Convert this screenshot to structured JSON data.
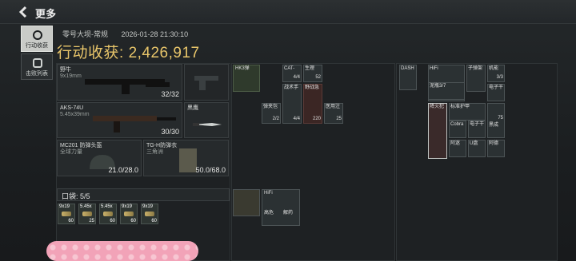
{
  "topbar": {
    "back_icon": "chevron-left-icon",
    "title": "更多"
  },
  "sidebar": {
    "items": [
      {
        "label": "行动收获",
        "icon": "target-icon",
        "active": true
      },
      {
        "label": "击败列表",
        "icon": "skull-icon",
        "active": false
      }
    ]
  },
  "header": {
    "map": "零号大坝-常规",
    "datetime": "2026-01-28 21:30:10",
    "loot_label": "行动收获:",
    "loot_value": "2,426,917"
  },
  "weapons": [
    {
      "name": "野牛",
      "ammo_type": "9x19mm",
      "value": "32/32"
    },
    {
      "name": "AKS-74U",
      "ammo_type": "5.45x39mm",
      "value": "30/30"
    }
  ],
  "melee": {
    "name": "黑鹰"
  },
  "armor": [
    {
      "name": "MC201 防弹头盔",
      "sub": "全球力量",
      "value": "21.0/28.0"
    },
    {
      "name": "TG-H防弹衣",
      "sub": "三角洲",
      "value": "50.0/68.0"
    }
  ],
  "pocket": {
    "label": "口袋: 5/5",
    "ammo": [
      {
        "type": "9x19",
        "count": "60"
      },
      {
        "type": "5.45x",
        "count": "25"
      },
      {
        "type": "5.45x",
        "count": "60"
      },
      {
        "type": "9x19",
        "count": "60"
      },
      {
        "type": "9x19",
        "count": "60"
      }
    ]
  },
  "rig": {
    "items": [
      {
        "name": "HK3弹",
        "count": ""
      },
      {
        "name": "CAT-",
        "count": "4/4"
      },
      {
        "name": "生理",
        "count": "52"
      },
      {
        "name": "战术手",
        "count": "4/4"
      },
      {
        "name": "野战急",
        "count": "220"
      },
      {
        "name": "弹夹包",
        "count": "2/2"
      },
      {
        "name": "医用注",
        "count": "25"
      }
    ]
  },
  "backpack": {
    "items": [
      {
        "name": "DASH",
        "count": ""
      },
      {
        "name": "HiFi",
        "count": ""
      },
      {
        "name": "子弹架",
        "count": ""
      },
      {
        "name": "机能",
        "count": "3/3"
      },
      {
        "name": "泥瓶3/7",
        "count": ""
      },
      {
        "name": "电子干",
        "count": ""
      },
      {
        "name": "降火犯",
        "count": ""
      },
      {
        "name": "标准护甲",
        "count": ""
      },
      {
        "name": "Cobra",
        "count": ""
      },
      {
        "name": "电子干",
        "count": ""
      },
      {
        "name": "黑成",
        "count": "75"
      },
      {
        "name": "阿迷",
        "count": ""
      },
      {
        "name": "U盘",
        "count": ""
      },
      {
        "name": "阿德",
        "count": ""
      }
    ]
  },
  "case": {
    "items": [
      {
        "name": "HiFi",
        "count": ""
      },
      {
        "name": "高危",
        "count": ""
      },
      {
        "name": "解药",
        "count": ""
      }
    ]
  },
  "colors": {
    "gold": "#e8c56a",
    "accent_red": "#3b2624"
  }
}
